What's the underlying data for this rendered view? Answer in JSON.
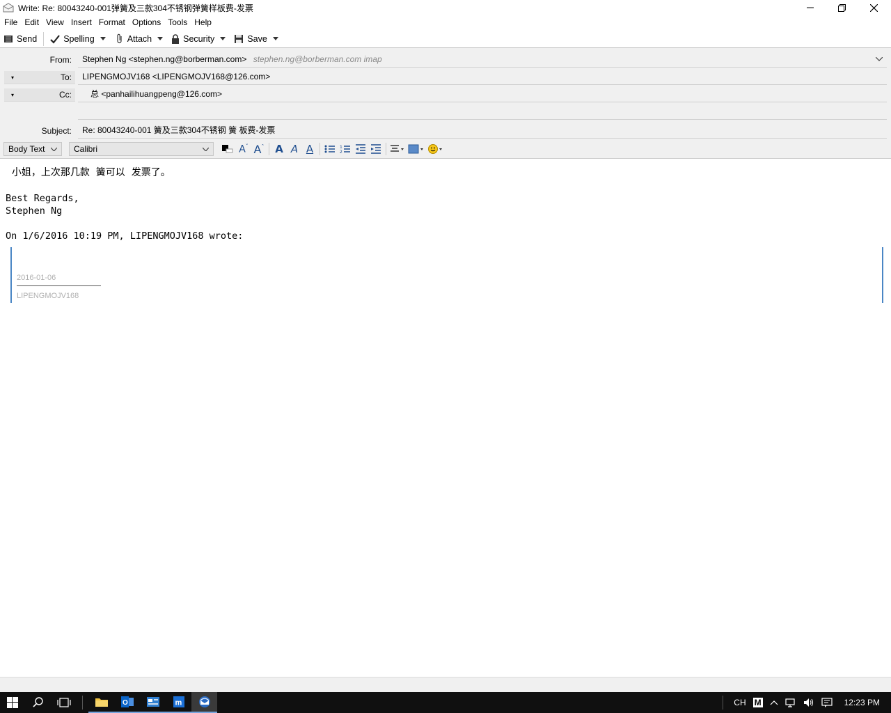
{
  "window": {
    "title": "Write: Re: 80043240-001弹簧及三款304不锈钢弹簧样板费-发票",
    "minimize_icon": "minimize-icon",
    "restore_icon": "restore-icon",
    "close_icon": "close-icon"
  },
  "menubar": {
    "items": [
      "File",
      "Edit",
      "View",
      "Insert",
      "Format",
      "Options",
      "Tools",
      "Help"
    ]
  },
  "toolbar": {
    "send": "Send",
    "spelling": "Spelling",
    "attach": "Attach",
    "security": "Security",
    "save": "Save"
  },
  "header": {
    "from_label": "From:",
    "from_value": "Stephen Ng <stephen.ng@borberman.com>",
    "from_account": "stephen.ng@borberman.com imap",
    "to_label": "To:",
    "to_value": "LIPENGMOJV168 <LIPENGMOJV168@126.com>",
    "cc_label": "Cc:",
    "cc_value": "总 <panhailihuangpeng@126.com>",
    "subject_label": "Subject:",
    "subject_value": "Re: 80043240-001   簧及三款304不锈钢   簧   板费-发票"
  },
  "formatbar": {
    "paragraph_style": "Body Text",
    "font": "Calibri"
  },
  "body": {
    "greeting": "  小姐，上次那几款  簧可以  发票了。",
    "regards": "Best Regards,",
    "signature": "Stephen Ng",
    "reply_header": "On 1/6/2016 10:19 PM, LIPENGMOJV168 wrote:",
    "quote_date": "2016-01-06",
    "quote_sender": "LIPENGMOJV168"
  },
  "taskbar": {
    "lang": "CH",
    "ime": "M",
    "clock": "12:23 PM"
  },
  "colors": {
    "accent": "#4a86c5",
    "taskbar": "#101010",
    "chrome": "#f0f0f0"
  }
}
